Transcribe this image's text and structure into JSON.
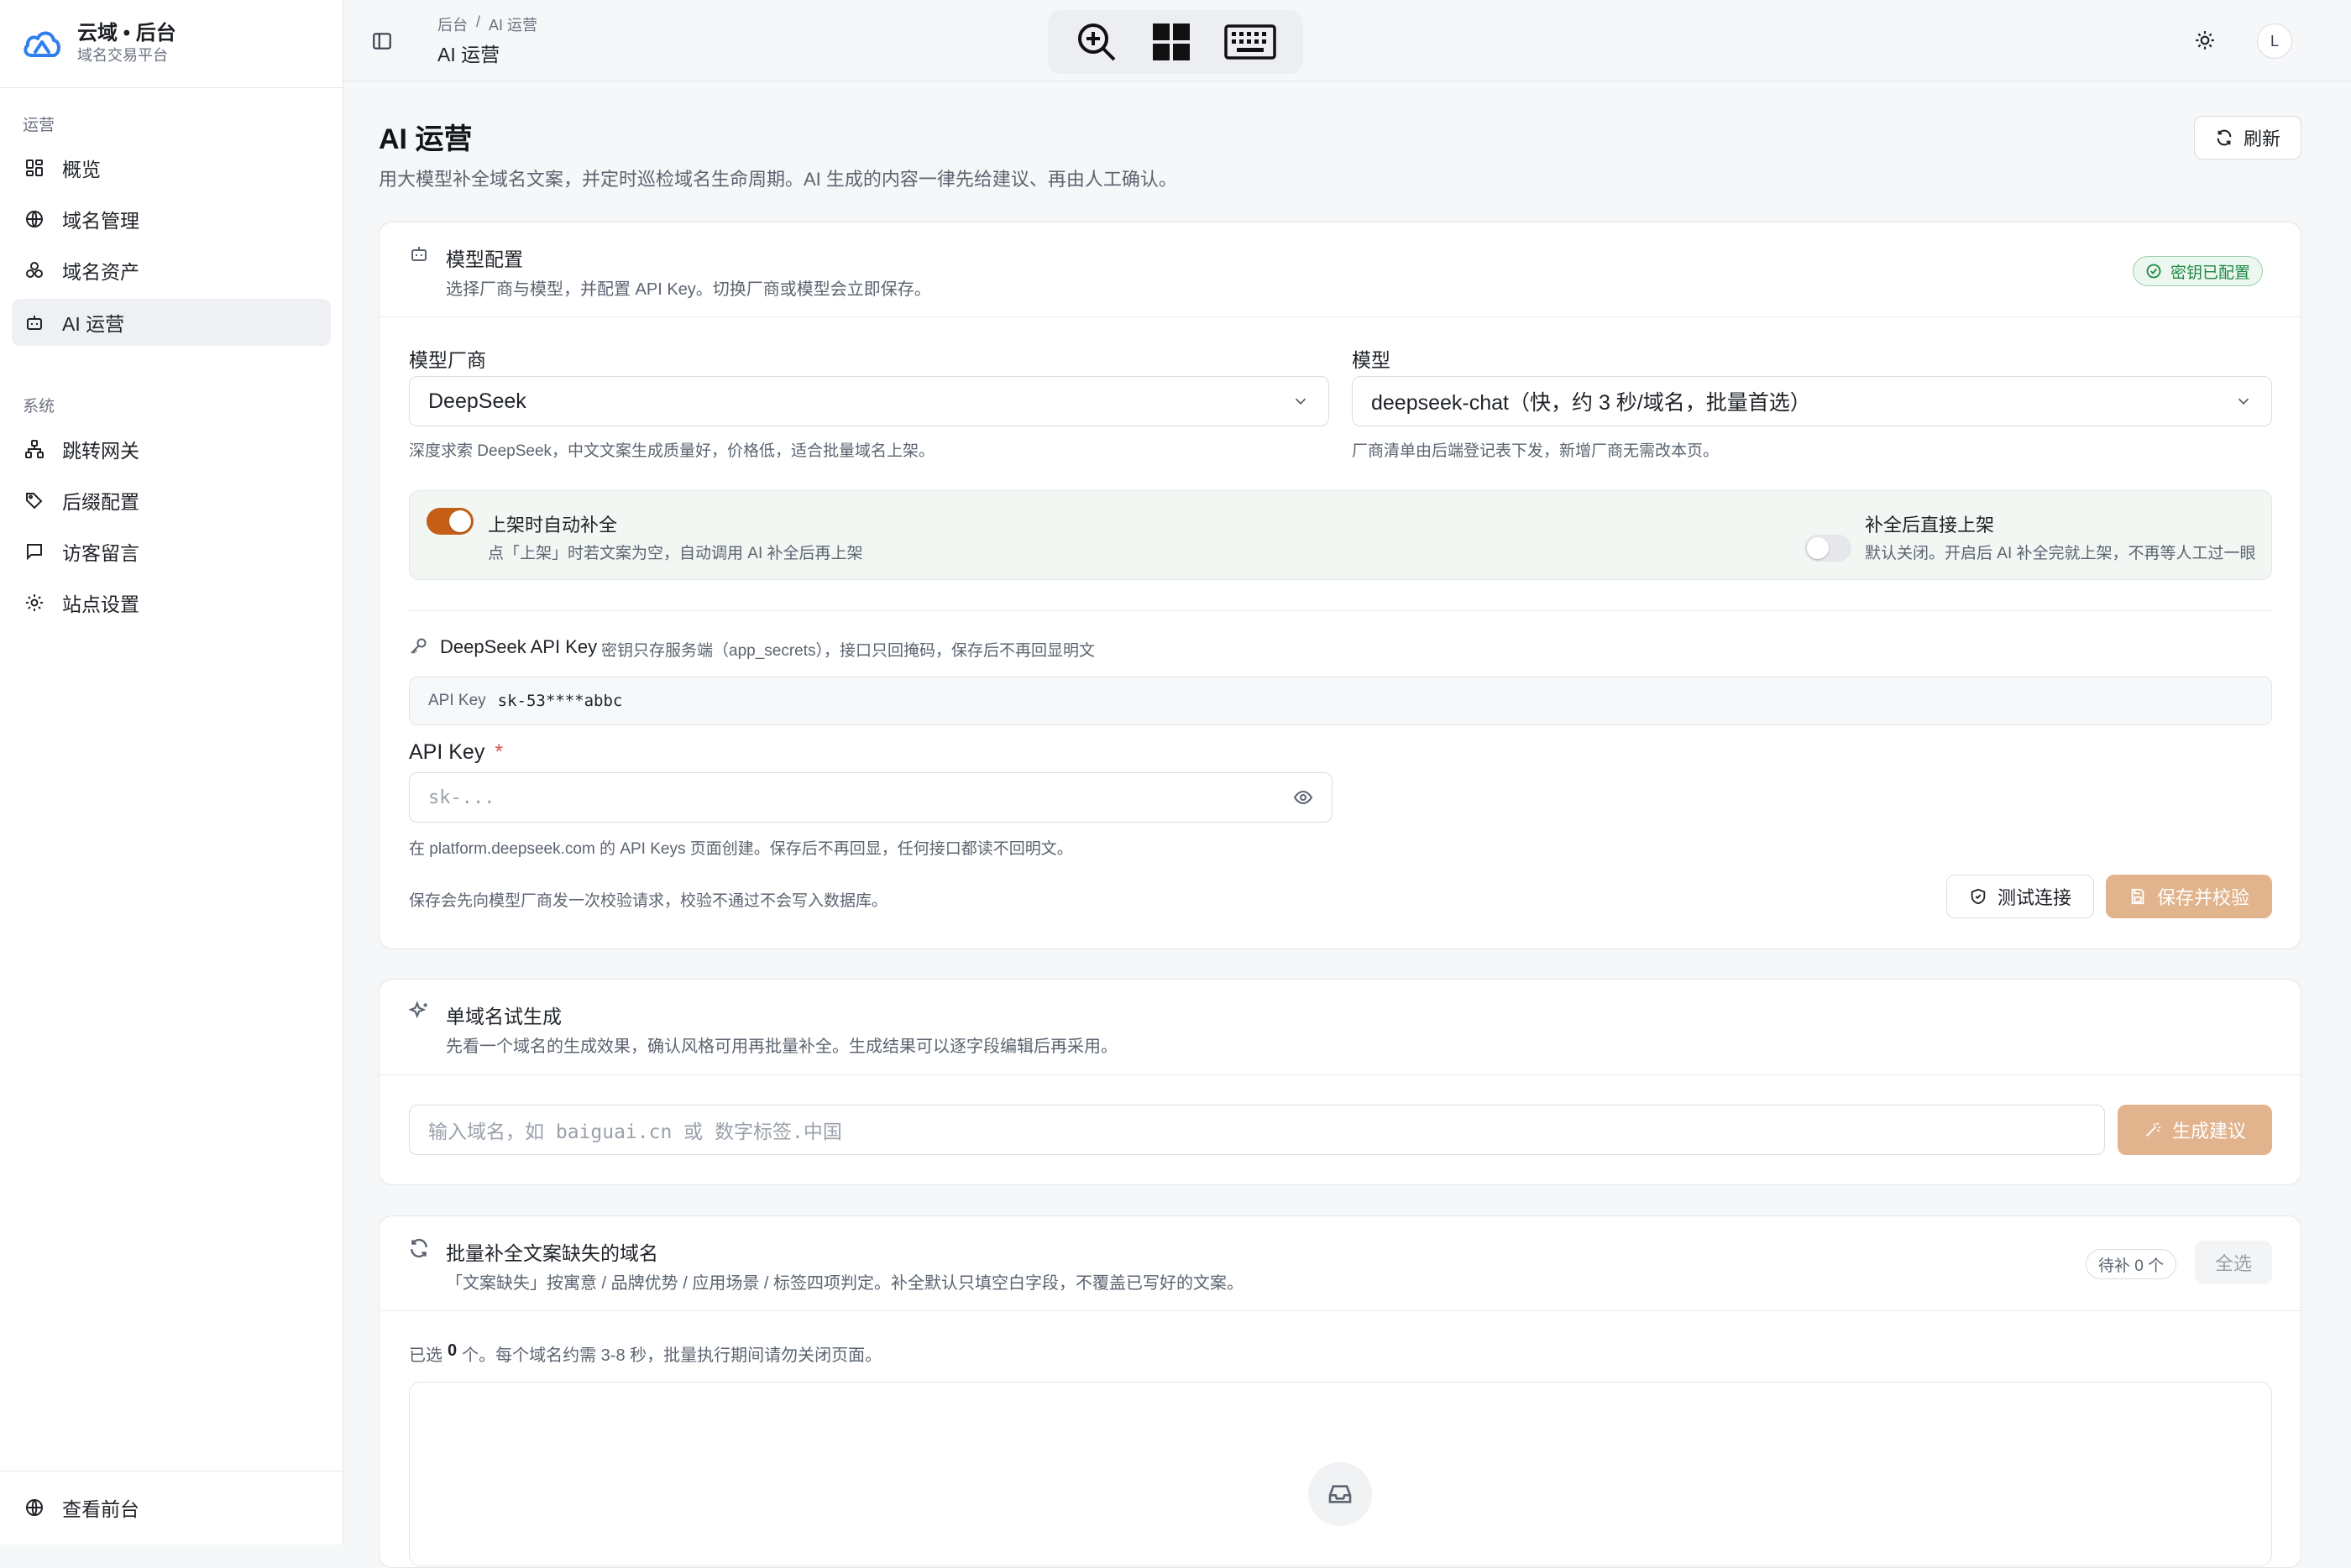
{
  "brand": {
    "title": "云域 • 后台",
    "subtitle": "域名交易平台"
  },
  "sidebar": {
    "group_ops": "运营",
    "group_sys": "系统",
    "items_ops": [
      {
        "label": "概览",
        "icon": "dashboard-icon"
      },
      {
        "label": "域名管理",
        "icon": "globe-icon"
      },
      {
        "label": "域名资产",
        "icon": "assets-icon"
      },
      {
        "label": "AI 运营",
        "icon": "bot-icon"
      }
    ],
    "items_sys": [
      {
        "label": "跳转网关",
        "icon": "network-icon"
      },
      {
        "label": "后缀配置",
        "icon": "tags-icon"
      },
      {
        "label": "访客留言",
        "icon": "message-icon"
      },
      {
        "label": "站点设置",
        "icon": "gear-icon"
      }
    ],
    "footer_label": "查看前台"
  },
  "topbar": {
    "breadcrumb_root": "后台",
    "breadcrumb_sep": "/",
    "breadcrumb_current": "AI 运营",
    "title": "AI 运营",
    "avatar_letter": "L"
  },
  "page": {
    "title": "AI 运营",
    "description": "用大模型补全域名文案，并定时巡检域名生命周期。AI 生成的内容一律先给建议、再由人工确认。",
    "refresh_label": "刷新"
  },
  "model_card": {
    "title": "模型配置",
    "description": "选择厂商与模型，并配置 API Key。切换厂商或模型会立即保存。",
    "badge": "密钥已配置",
    "vendor_label": "模型厂商",
    "vendor_value": "DeepSeek",
    "vendor_hint": "深度求索 DeepSeek，中文文案生成质量好，价格低，适合批量域名上架。",
    "model_label": "模型",
    "model_value": "deepseek-chat（快，约 3 秒/域名，批量首选）",
    "model_hint": "厂商清单由后端登记表下发，新增厂商无需改本页。",
    "toggle1_title": "上架时自动补全",
    "toggle1_desc": "点「上架」时若文案为空，自动调用 AI 补全后再上架",
    "toggle1_on": true,
    "toggle2_title": "补全后直接上架",
    "toggle2_desc": "默认关闭。开启后 AI 补全完就上架，不再等人工过一眼",
    "toggle2_on": false,
    "key_section_title": "DeepSeek API Key",
    "key_section_note": "密钥只存服务端（app_secrets），接口只回掩码，保存后不再回显明文",
    "key_display_label": "API Key",
    "key_display_value": "sk-53****abbc",
    "api_key_label": "API Key",
    "api_key_required": "*",
    "api_key_placeholder": "sk-...",
    "api_key_hint": "在 platform.deepseek.com 的 API Keys 页面创建。保存后不再回显，任何接口都读不回明文。",
    "save_note": "保存会先向模型厂商发一次校验请求，校验不通过不会写入数据库。",
    "test_label": "测试连接",
    "save_label": "保存并校验"
  },
  "single_card": {
    "title": "单域名试生成",
    "description": "先看一个域名的生成效果，确认风格可用再批量补全。生成结果可以逐字段编辑后再采用。",
    "input_placeholder": "输入域名，如 baiguai.cn 或 数字标签.中国",
    "generate_label": "生成建议"
  },
  "batch_card": {
    "title": "批量补全文案缺失的域名",
    "description": "「文案缺失」按寓意 / 品牌优势 / 应用场景 / 标签四项判定。补全默认只填空白字段，不覆盖已写好的文案。",
    "pending_badge": "待补 0 个",
    "select_all": "全选",
    "selected_prefix": "已选",
    "selected_count": "0",
    "selected_suffix": "个。每个域名约需 3-8 秒，批量执行期间请勿关闭页面。"
  },
  "colors": {
    "accent": "#c65f16",
    "accent_soft": "#e2b48e",
    "success": "#1f8a45",
    "brand_blue": "#2f80ed"
  }
}
